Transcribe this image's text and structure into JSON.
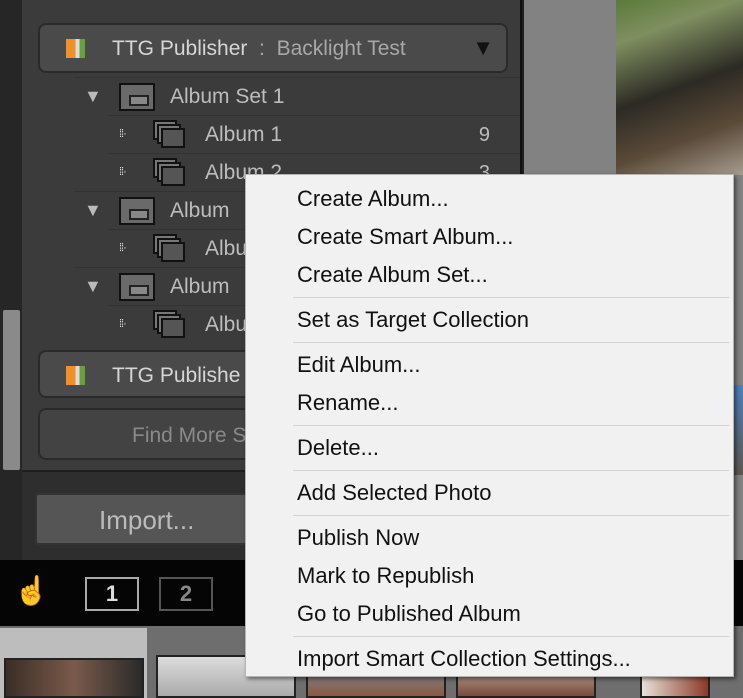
{
  "publish_panel": {
    "service1": {
      "name": "TTG Publisher",
      "separator": ":",
      "account": "Backlight Test"
    },
    "tree": [
      {
        "type": "set",
        "label": "Album Set 1"
      },
      {
        "type": "album",
        "label": "Album 1",
        "count": "9"
      },
      {
        "type": "album",
        "label": "Album 2",
        "count": "3"
      },
      {
        "type": "set",
        "label": "Album"
      },
      {
        "type": "album",
        "label": "Albu"
      },
      {
        "type": "set",
        "label": "Album"
      },
      {
        "type": "album",
        "label": "Albu"
      }
    ],
    "service2": {
      "name": "TTG Publishe"
    },
    "find_more": "Find More S"
  },
  "import_button": "Import...",
  "toolbar": {
    "screen1": "1",
    "screen2": "2"
  },
  "context_menu": [
    [
      "Create Album...",
      "Create Smart Album...",
      "Create Album Set..."
    ],
    [
      "Set as Target Collection"
    ],
    [
      "Edit Album...",
      "Rename..."
    ],
    [
      "Delete..."
    ],
    [
      "Add Selected Photo"
    ],
    [
      "Publish Now",
      "Mark to Republish",
      "Go to Published Album"
    ],
    [
      "Import Smart Collection Settings..."
    ]
  ]
}
